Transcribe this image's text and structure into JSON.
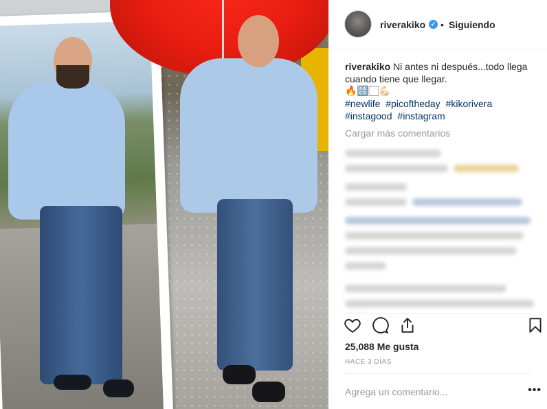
{
  "post": {
    "username": "riverakiko",
    "follow_status": "Siguiendo",
    "caption_user": "riverakiko",
    "caption_text": "Ni antes ni después...todo llega cuando tiene que llegar.",
    "emojis": "🔥🔠🏻💪🏻",
    "hashtags": [
      "#newlife",
      "#picoftheday",
      "#kikorivera",
      "#instagood",
      "#instagram"
    ],
    "load_more": "Cargar más comentarios",
    "likes": "25,088 Me gusta",
    "timestamp": "HACE 3 DÍAS",
    "add_comment_placeholder": "Agrega un comentario...",
    "more_options": "•••"
  },
  "colors": {
    "verified": "#3897f0",
    "hashtag": "#003569",
    "muted": "#999999",
    "umbrella": "#e81d10"
  },
  "icons": [
    "verified-badge-icon",
    "heart-icon",
    "comment-icon",
    "share-icon",
    "bookmark-icon",
    "more-options-icon"
  ]
}
